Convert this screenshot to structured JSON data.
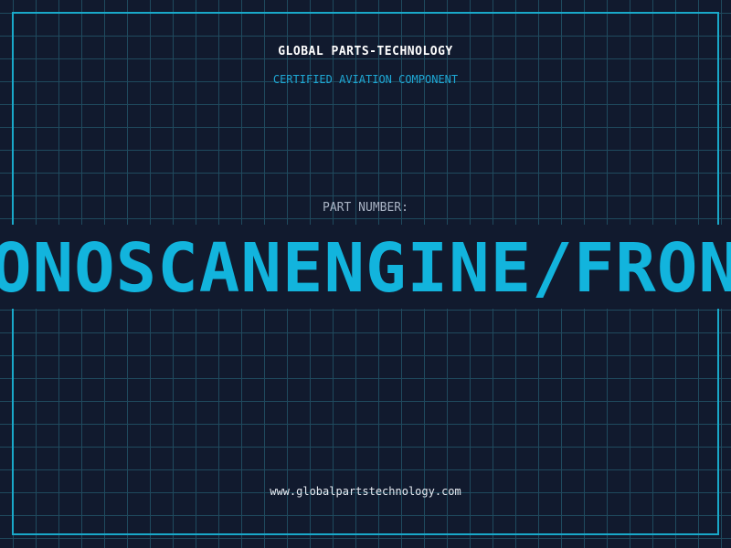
{
  "header": {
    "title": "GLOBAL PARTS-TECHNOLOGY",
    "subtitle": "CERTIFIED AVIATION COMPONENT"
  },
  "part": {
    "label": "PART NUMBER:",
    "number": "ONOSCANENGINE/FRON"
  },
  "footer": {
    "url": "www.globalpartstechnology.com"
  },
  "colors": {
    "background": "#111a2e",
    "grid": "#1f4a5e",
    "accent": "#12b4dd",
    "frame": "#19a8c9"
  }
}
